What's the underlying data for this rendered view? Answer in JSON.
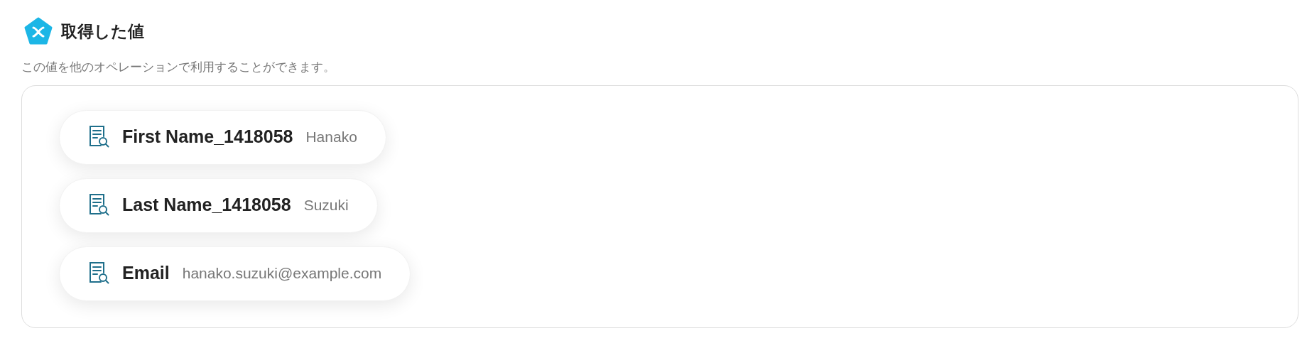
{
  "section": {
    "title": "取得した値",
    "description": "この値を他のオペレーションで利用することができます。"
  },
  "values": [
    {
      "label": "First Name_1418058",
      "value": "Hanako"
    },
    {
      "label": "Last Name_1418058",
      "value": "Suzuki"
    },
    {
      "label": "Email",
      "value": "hanako.suzuki@example.com"
    }
  ]
}
